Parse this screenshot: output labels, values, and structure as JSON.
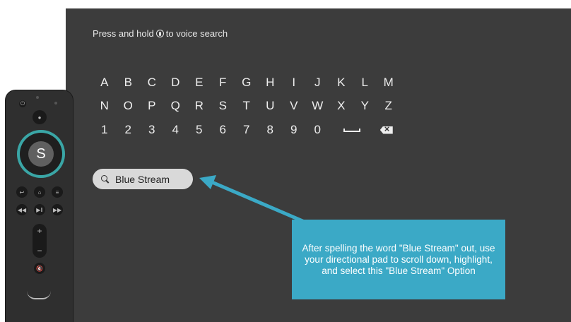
{
  "hint": {
    "before": "Press and hold",
    "icon": "voice-mic-icon",
    "after": "to voice search"
  },
  "keyboard": {
    "row1": [
      "A",
      "B",
      "C",
      "D",
      "E",
      "F",
      "G",
      "H",
      "I",
      "J",
      "K",
      "L",
      "M"
    ],
    "row2": [
      "N",
      "O",
      "P",
      "Q",
      "R",
      "S",
      "T",
      "U",
      "V",
      "W",
      "X",
      "Y",
      "Z"
    ],
    "row3": [
      "1",
      "2",
      "3",
      "4",
      "5",
      "6",
      "7",
      "8",
      "9",
      "0"
    ],
    "space_icon": "space-icon",
    "backspace_icon": "backspace-icon"
  },
  "suggestion": {
    "icon": "search-icon",
    "label": "Blue Stream"
  },
  "callout": {
    "text": "After spelling the word \"Blue Stream\" out, use your directional pad to scroll down, highlight, and select this \"Blue Stream\" Option"
  },
  "remote": {
    "select_label": "S",
    "plus_label": "+",
    "minus_label": "−",
    "ring_color": "#3aa6a6"
  },
  "colors": {
    "screen": "#3c3c3c",
    "callout": "#3ba9c6",
    "arrow": "#3ba9c6"
  }
}
